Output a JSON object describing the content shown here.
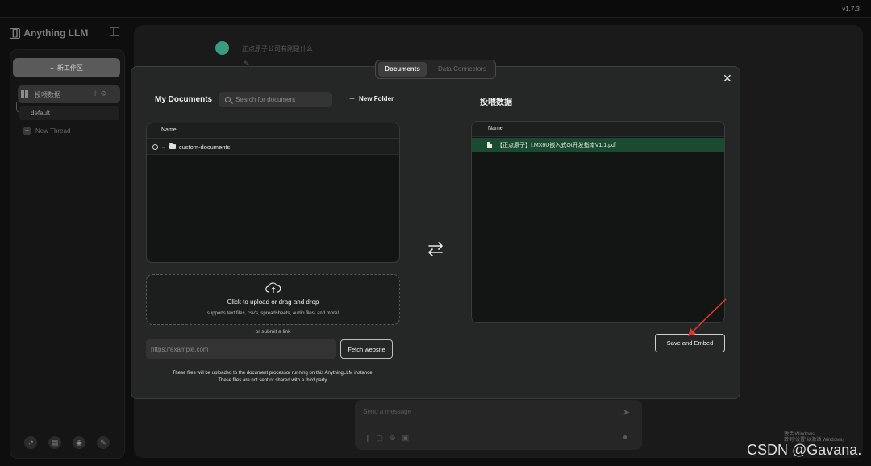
{
  "app": {
    "version": "v1.7.3",
    "logo_text": "Anything LLM"
  },
  "sidebar": {
    "new_workspace_label": "新工作区",
    "workspace_name": "投喂数据",
    "thread_default": "default",
    "new_thread_label": "New Thread"
  },
  "chat": {
    "question": "正点原子公司有刚是什么",
    "edit_glyph": "✎",
    "message_placeholder": "Send a message"
  },
  "modal": {
    "tabs": [
      {
        "label": "Documents",
        "active": true
      },
      {
        "label": "Data Connectors",
        "active": false
      }
    ],
    "close_glyph": "✕",
    "my_documents": {
      "title": "My Documents",
      "search_placeholder": "Search for document",
      "new_folder_label": "New Folder",
      "column_name": "Name",
      "folders": [
        {
          "name": "custom-documents"
        }
      ]
    },
    "upload": {
      "title": "Click to upload or drag and drop",
      "subtitle": "supports text files, csv's, spreadsheets, audio files, and more!",
      "or_link": "or submit a link",
      "url_placeholder": "https://example.com",
      "fetch_label": "Fetch website",
      "notice_line1": "These files will be uploaded to the document processor running on this AnythingLLM instance.",
      "notice_line2": "These files are not sent or shared with a third party."
    },
    "workspace": {
      "title": "投喂数据",
      "column_name": "Name",
      "files": [
        {
          "name": "【正点原子】I.MX6U嵌入式Qt开发指南V1.1.pdf"
        }
      ],
      "save_label": "Save and Embed"
    }
  },
  "overlay": {
    "windows_activate_line1": "激活 Windows",
    "windows_activate_line2": "转到\"设置\"以激活 Windows。",
    "watermark": "CSDN @Gavana."
  },
  "colors": {
    "selected_file_row": "#1a4a2f",
    "avatar": "#3a9c7e",
    "annotation_arrow": "#e0382f"
  }
}
